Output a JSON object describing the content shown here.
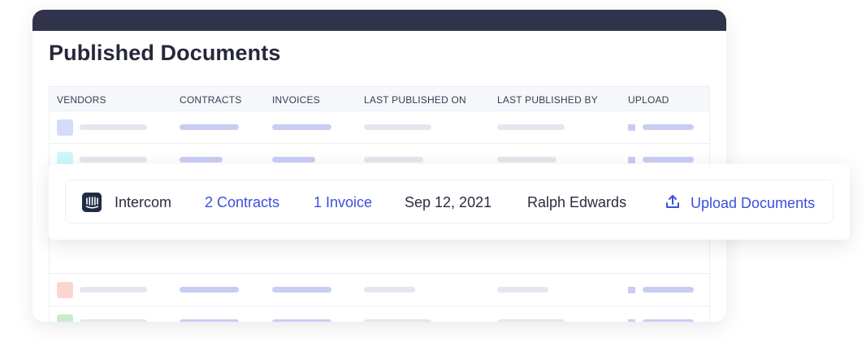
{
  "panel": {
    "title": "Published Documents"
  },
  "table": {
    "columns": [
      "VENDORS",
      "CONTRACTS",
      "INVOICES",
      "LAST PUBLISHED ON",
      "LAST PUBLISHED BY",
      "UPLOAD"
    ],
    "placeholder_swatch_colors": [
      "#d6dafb",
      "#ccf9fb",
      "#fbd6cf",
      "#c9edc9"
    ]
  },
  "highlighted_row": {
    "vendor": "Intercom",
    "contracts": "2 Contracts",
    "invoices": "1 Invoice",
    "last_published_on": "Sep 12, 2021",
    "last_published_by": "Ralph Edwards",
    "upload_label": "Upload Documents",
    "logo_icon": "intercom-logo",
    "upload_icon": "upload-icon"
  },
  "colors": {
    "header_bar": "#30334a",
    "link": "#3b4fe0",
    "placeholder_grey": "#e5e7ee",
    "placeholder_blue": "#c9cdf4"
  }
}
